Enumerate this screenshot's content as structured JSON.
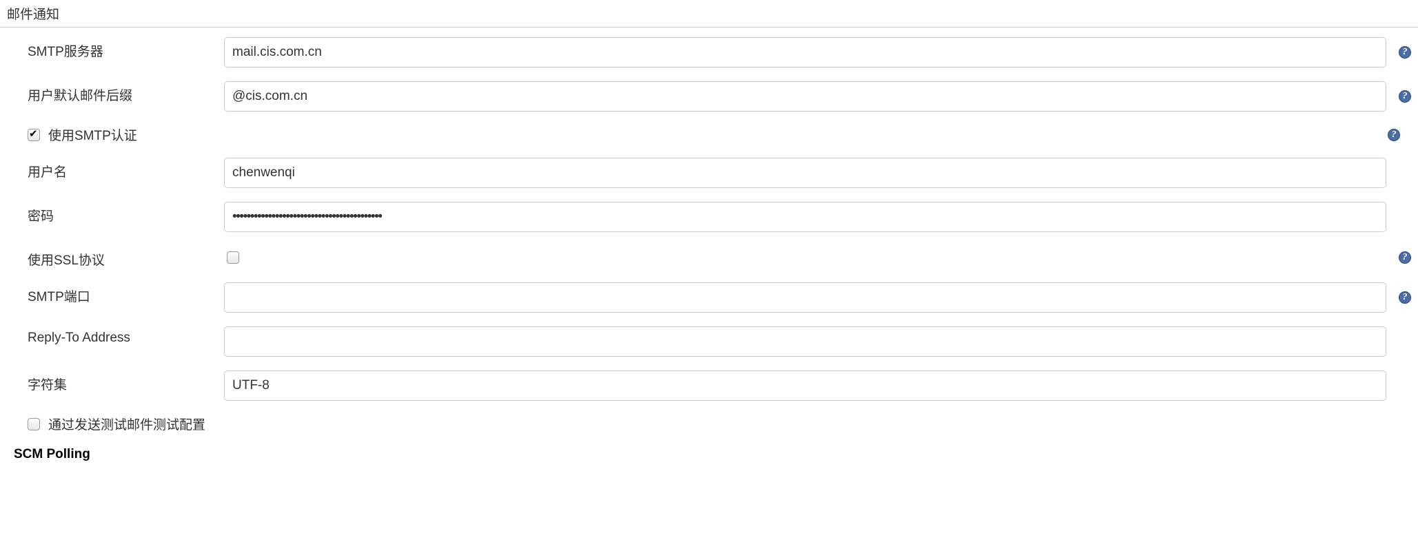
{
  "section": {
    "title": "邮件通知"
  },
  "fields": {
    "smtp_server": {
      "label": "SMTP服务器",
      "value": "mail.cis.com.cn"
    },
    "default_suffix": {
      "label": "用户默认邮件后缀",
      "value": "@cis.com.cn"
    },
    "use_smtp_auth": {
      "label": "使用SMTP认证",
      "checked": true
    },
    "username": {
      "label": "用户名",
      "value": "chenwenqi"
    },
    "password": {
      "label": "密码",
      "value": "••••••••••••••••••••••••••••••••••••••••••"
    },
    "use_ssl": {
      "label": "使用SSL协议",
      "checked": false
    },
    "smtp_port": {
      "label": "SMTP端口",
      "value": ""
    },
    "reply_to": {
      "label": "Reply-To Address",
      "value": ""
    },
    "charset": {
      "label": "字符集",
      "value": "UTF-8"
    },
    "test_email": {
      "label": "通过发送测试邮件测试配置",
      "checked": false
    }
  },
  "next_section": {
    "title": "SCM Polling"
  }
}
